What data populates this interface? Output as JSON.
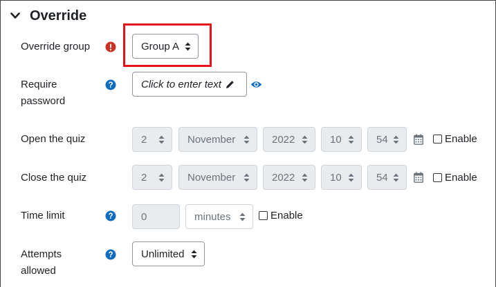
{
  "section": {
    "title": "Override",
    "expanded": true
  },
  "override_group": {
    "label": "Override group",
    "value": "Group A",
    "status_icon": "exclamation-circle-icon",
    "status_color": "#ca3120"
  },
  "require_password": {
    "label_line1": "Require",
    "label_line2": "password",
    "placeholder": "Click to enter text",
    "edit_icon": "pencil-icon",
    "reveal_icon": "eye-icon"
  },
  "open_quiz": {
    "label": "Open the quiz",
    "day": "2",
    "month": "November",
    "year": "2022",
    "hour": "10",
    "minute": "54",
    "enable_label": "Enable",
    "enabled": false
  },
  "close_quiz": {
    "label": "Close the quiz",
    "day": "2",
    "month": "November",
    "year": "2022",
    "hour": "10",
    "minute": "54",
    "enable_label": "Enable",
    "enabled": false
  },
  "time_limit": {
    "label": "Time limit",
    "value": "0",
    "unit": "minutes",
    "enable_label": "Enable",
    "enabled": false
  },
  "attempts": {
    "label_line1": "Attempts",
    "label_line2": "allowed",
    "value": "Unlimited"
  },
  "colors": {
    "help_icon": "#0f6cbf",
    "error_icon": "#ca3120",
    "highlight": "#e3121b"
  }
}
